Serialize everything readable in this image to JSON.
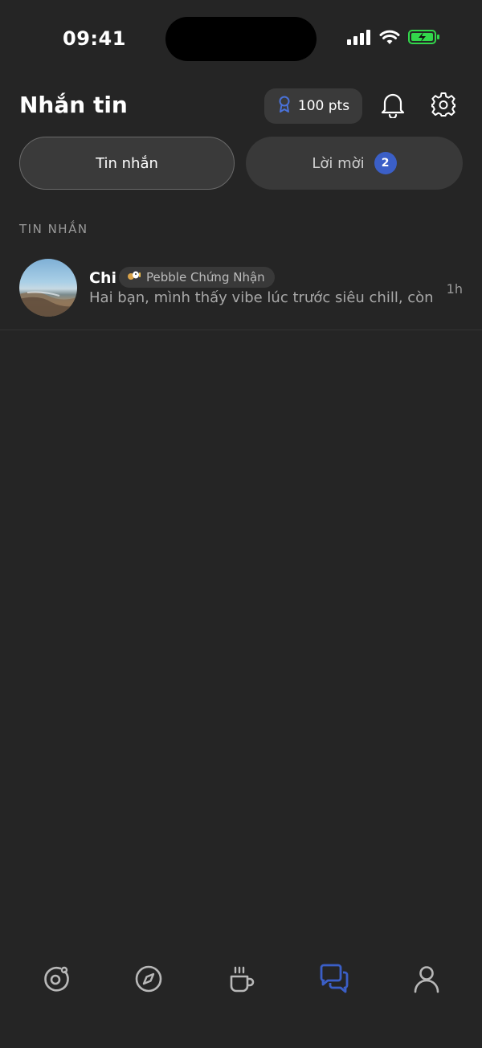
{
  "status_bar": {
    "time": "09:41",
    "icons": [
      "cellular-signal-icon",
      "wifi-icon",
      "battery-charging-icon"
    ]
  },
  "header": {
    "title": "Nhắn tin",
    "points_label": "100 pts",
    "icons": [
      "award-ribbon-icon",
      "bell-icon",
      "gear-icon"
    ]
  },
  "tabs": [
    {
      "label": "Tin nhắn",
      "active": true
    },
    {
      "label": "Lời mời",
      "active": false,
      "badge": "2"
    }
  ],
  "section_label": "TIN NHẮN",
  "messages": [
    {
      "name": "Chi",
      "badge_label": "Pebble Chứng Nhận",
      "preview": "Hai bạn, mình thấy vibe lúc trước siêu chill, còn…",
      "time": "1h"
    }
  ],
  "nav": [
    {
      "icon": "orbit-icon",
      "active": false
    },
    {
      "icon": "compass-icon",
      "active": false
    },
    {
      "icon": "coffee-cup-icon",
      "active": false
    },
    {
      "icon": "chat-bubbles-icon",
      "active": true
    },
    {
      "icon": "user-profile-icon",
      "active": false
    }
  ],
  "colors": {
    "background": "#252525",
    "accent": "#3b5fc7",
    "chip": "#3a3a3a",
    "battery_green": "#32d74b"
  }
}
